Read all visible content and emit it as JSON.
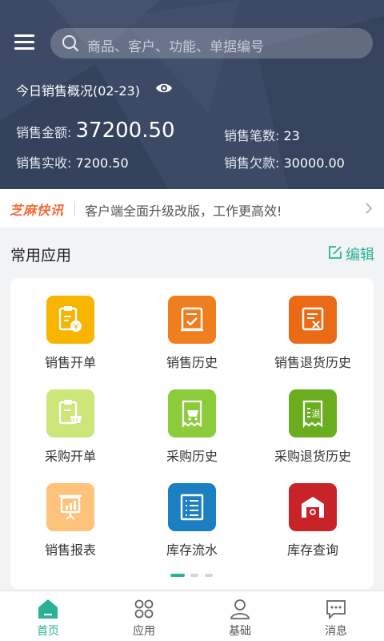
{
  "header": {
    "search_placeholder": "商品、客户、功能、单据编号",
    "summary_title": "今日销售概况(02-23)",
    "stats": {
      "sales_amount_label": "销售金额:",
      "sales_amount_value": "37200.50",
      "sales_count_label": "销售笔数:",
      "sales_count_value": "23",
      "received_label": "销售实收:",
      "received_value": "7200.50",
      "debt_label": "销售欠款:",
      "debt_value": "30000.00"
    }
  },
  "news": {
    "brand": "芝麻快讯",
    "text": "客户端全面升级改版，工作更高效!"
  },
  "section": {
    "title": "常用应用",
    "edit_label": "编辑"
  },
  "apps": [
    {
      "label": "销售开单",
      "color": "#f7b500",
      "icon": "sales-order-icon"
    },
    {
      "label": "销售历史",
      "color": "#ef7e1e",
      "icon": "sales-history-icon"
    },
    {
      "label": "销售退货历史",
      "color": "#ea6a16",
      "icon": "sales-return-history-icon"
    },
    {
      "label": "采购开单",
      "color": "#cde67a",
      "icon": "purchase-order-icon"
    },
    {
      "label": "采购历史",
      "color": "#8ccb3a",
      "icon": "purchase-history-icon"
    },
    {
      "label": "采购退货历史",
      "color": "#6aae20",
      "icon": "purchase-return-history-icon"
    },
    {
      "label": "销售报表",
      "color": "#fdc37a",
      "icon": "sales-report-icon"
    },
    {
      "label": "库存流水",
      "color": "#1b7fc1",
      "icon": "inventory-flow-icon"
    },
    {
      "label": "库存查询",
      "color": "#c9232a",
      "icon": "inventory-query-icon"
    }
  ],
  "pagination": {
    "pages": 3,
    "active": 1
  },
  "tabs": [
    {
      "label": "首页",
      "icon": "home-icon",
      "active": true
    },
    {
      "label": "应用",
      "icon": "apps-icon",
      "active": false
    },
    {
      "label": "基础",
      "icon": "user-icon",
      "active": false
    },
    {
      "label": "消息",
      "icon": "message-icon",
      "active": false
    }
  ],
  "colors": {
    "header_bg": "#3c4a66",
    "accent": "#29b394",
    "brand_orange": "#f26b3a"
  }
}
